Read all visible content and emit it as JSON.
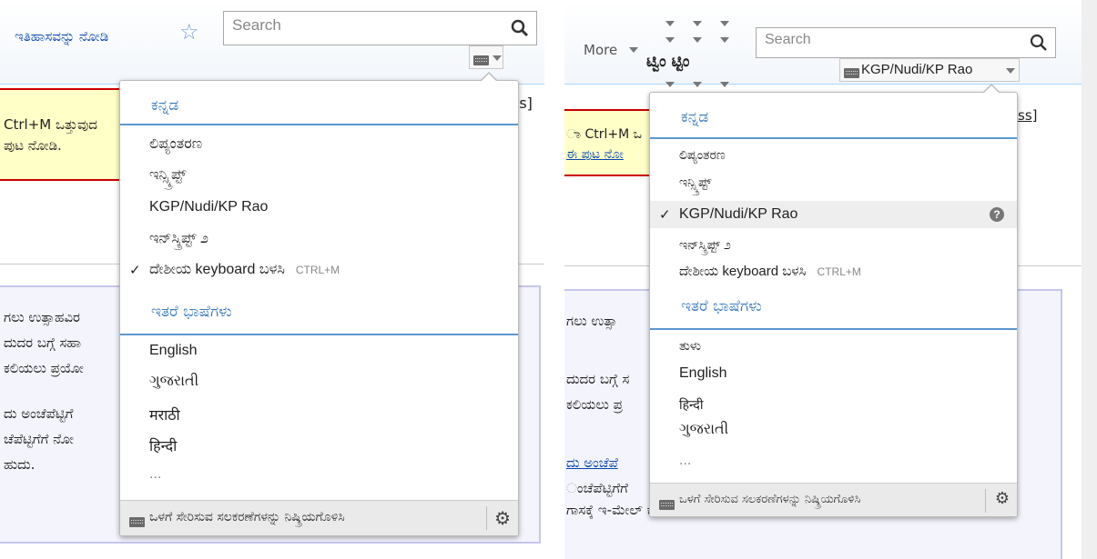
{
  "left": {
    "tab_view_history": "ಇತಿಹಾಸವನ್ನು ನೋಡಿ",
    "search_placeholder": "Search",
    "notice_line1": "Ctrl+M ಒತ್ತುವುದ",
    "notice_line2": "ಪುಟ ನೋಡಿ.",
    "bracket_text": "ss]",
    "body_lines": [
      "ಗಲು ಉತ್ಸಾಹವಿರ",
      "ದುದರ ಬಗ್ಗೆ ಸಹಾ",
      "ಕಲಿಯಲು ಪ್ರಯೋ",
      "ದು ಅಂಚೆಪೆಟ್ಟಿಗೆ",
      "ಚೆಪೆಟ್ಟಿಗೆಗೆ ನೋ",
      "ಹುದು."
    ],
    "menu": {
      "section1": "ಕನ್ನಡ",
      "items1": [
        "ಲಿಪ್ಯಂತರಣ",
        "ಇನ್ಸ್ಕ್ರಿಪ್ಟ್",
        "KGP/Nudi/KP Rao",
        "ಇನ್‌ಸ್ಕ್ರಿಪ್ಟ್ ೨"
      ],
      "native_item": "ದೇಶೀಯ keyboard ಬಳಸಿ",
      "native_shortcut": "CTRL+M",
      "section2": "ಇತರೆ ಭಾಷೆಗಳು",
      "items2": [
        "English",
        "ગુજરાતી",
        "मराठी",
        "हिन्दी"
      ],
      "more": "...",
      "footer": "ಒಳಗೆ ಸೇರಿಸುವ ಸಲಕರಣೆಗಳನ್ನು ನಿಷ್ಕ್ರಿಯಗೊಳಿಸಿ"
    }
  },
  "right": {
    "more_tab": "More",
    "tizen_text": "ಟ್ವಿಂ ಟ್ಟಿಂ",
    "search_placeholder": "Search",
    "kbd_label": "KGP/Nudi/KP Rao",
    "notice_line1": "ಾ Ctrl+M ಒ",
    "notice_line2": "ಈ ಪುಟ ನೋ",
    "bracket_text": "ss]",
    "body_lines": [
      "ಗಲು ಉತ್ಸಾ",
      "ದುದರ ಬಗ್ಗೆ ಸ",
      "ಕಲಿಯಲು ಪ್ರ",
      "ದು ಅಂಚೆಪೆ",
      "ಂಚೆಪೆಟ್ಟಿಗೆಗೆ",
      "ಗಾಸಕ್ಕೆ ಇ-ಮೇಲ್ ಕಳುಹಿಸಬಹುದು."
    ],
    "menu": {
      "section1": "ಕನ್ನಡ",
      "items1": [
        "ಲಿಪ್ಯಂತರಣ",
        "ಇನ್ಸ್ಕ್ರಿಪ್ಟ್",
        "KGP/Nudi/KP Rao",
        "ಇನ್‌ಸ್ಕ್ರಿಪ್ಟ್ ೨"
      ],
      "help": "?",
      "native_item": "ದೇಶೀಯ keyboard ಬಳಸಿ",
      "native_shortcut": "CTRL+M",
      "section2": "ಇತರೆ ಭಾಷೆಗಳು",
      "items2": [
        "ತುಳು",
        "English",
        "हिन्दी",
        "ગુજરાતી"
      ],
      "more": "...",
      "footer": "ಒಳಗೆ ಸೇರಿಸುವ ಸಲಕರಣೆಗಳನ್ನು ನಿಷ್ಕ್ರಿಯಗೊಳಿಸಿ"
    }
  },
  "check_mark": "✓",
  "star_glyph": "☆",
  "gear_glyph": "⚙",
  "colors": {
    "link": "#0645ad",
    "section_blue": "#3a7abf",
    "notice_bg": "#ffffc8",
    "notice_border": "#cc0000",
    "box_border": "#c6c6ee"
  }
}
